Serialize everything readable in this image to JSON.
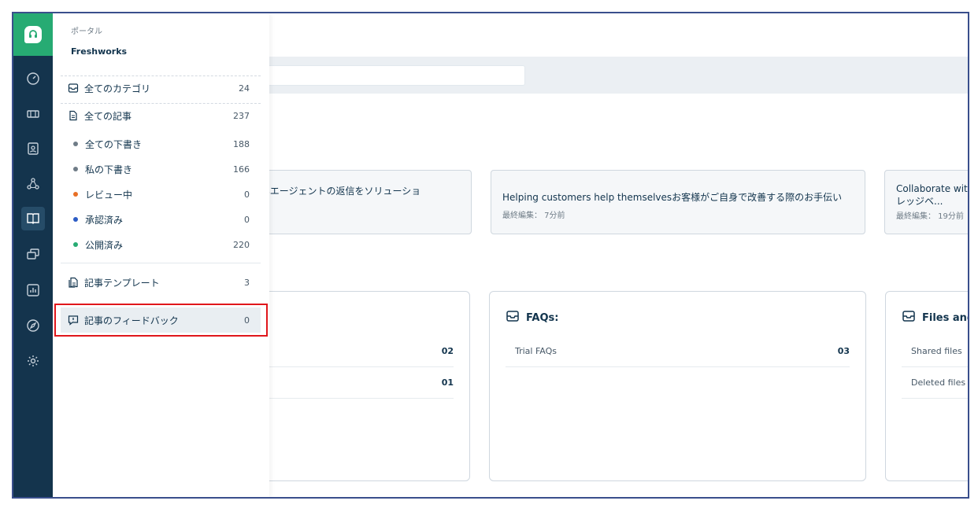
{
  "panel": {
    "portal_label": "ポータル",
    "portal_name": "Freshworks",
    "items": [
      {
        "label": "全てのカテゴリ",
        "count": "24",
        "icon": "inbox-icon"
      },
      {
        "label": "全ての記事",
        "count": "237",
        "icon": "document-icon"
      },
      {
        "label": "全ての下書き",
        "count": "188",
        "dot": "#6f7c87"
      },
      {
        "label": "私の下書き",
        "count": "166",
        "dot": "#6f7c87"
      },
      {
        "label": "レビュー中",
        "count": "0",
        "dot": "#e86f25"
      },
      {
        "label": "承認済み",
        "count": "0",
        "dot": "#2c5cc5"
      },
      {
        "label": "公開済み",
        "count": "220",
        "dot": "#27ab73"
      },
      {
        "label": "記事テンプレート",
        "count": "3",
        "icon": "template-icon"
      },
      {
        "label": "記事のフィードバック",
        "count": "0",
        "icon": "feedback-icon"
      }
    ]
  },
  "articles": [
    {
      "title": "Articlesエージェントの返信をソリューショ",
      "meta": ""
    },
    {
      "title": "Helping customers help themselvesお客様がご自身で改善する際のお手伝い",
      "meta": "最終編集： 7分前"
    },
    {
      "title": "Collaborate with",
      "title2": "レッジベ...",
      "meta": "最終編集： 19分前"
    }
  ],
  "categories": [
    {
      "title": "",
      "rows": [
        {
          "name": "",
          "count": "02"
        },
        {
          "name": "",
          "count": "01"
        }
      ]
    },
    {
      "title": "FAQs:",
      "rows": [
        {
          "name": "Trial FAQs",
          "count": "03"
        }
      ]
    },
    {
      "title": "Files and",
      "rows": [
        {
          "name": "Shared files",
          "count": ""
        },
        {
          "name": "Deleted files",
          "count": ""
        }
      ]
    }
  ],
  "colors": {
    "rail": "#14344d",
    "brand": "#27ab73",
    "highlight_border": "#e0161b"
  }
}
